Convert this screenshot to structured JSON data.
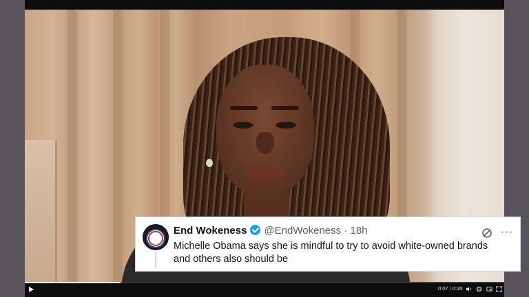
{
  "tweet": {
    "author_name": "End Wokeness",
    "handle": "@EndWokeness",
    "separator": "·",
    "time": "18h",
    "text": "Michelle Obama says she is mindful to try to avoid white-owned brands and others also should be",
    "icons": {
      "avatar": "circular-badge-avatar",
      "verified": "verified-badge-icon",
      "grok": "grok-icon",
      "more": "more-options-icon"
    },
    "verified_color": "#1d9bf0"
  },
  "player": {
    "current_time": "0:07",
    "duration": "0:35",
    "time_separator": "/",
    "progress_fraction": 0.2,
    "icons": [
      "play-icon",
      "volume-icon",
      "settings-icon",
      "pip-icon",
      "fullscreen-icon"
    ]
  }
}
